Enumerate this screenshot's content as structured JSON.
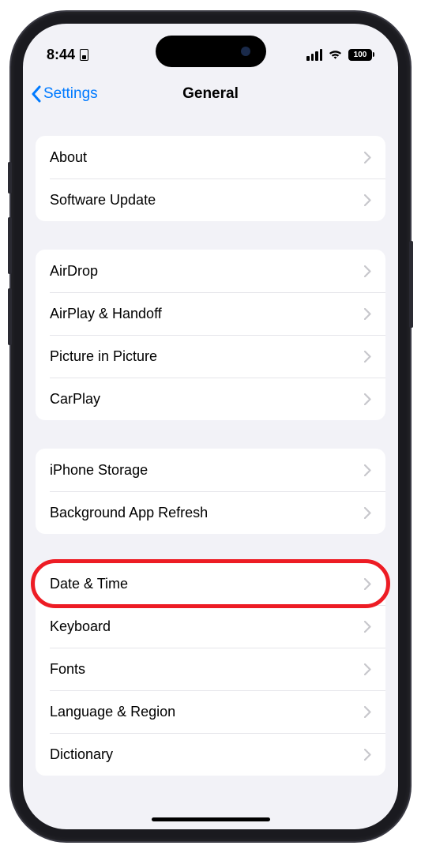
{
  "status": {
    "time": "8:44",
    "battery": "100"
  },
  "nav": {
    "back_label": "Settings",
    "title": "General"
  },
  "groups": [
    {
      "items": [
        {
          "key": "about",
          "label": "About"
        },
        {
          "key": "software-update",
          "label": "Software Update"
        }
      ]
    },
    {
      "items": [
        {
          "key": "airdrop",
          "label": "AirDrop"
        },
        {
          "key": "airplay-handoff",
          "label": "AirPlay & Handoff"
        },
        {
          "key": "picture-in-picture",
          "label": "Picture in Picture"
        },
        {
          "key": "carplay",
          "label": "CarPlay"
        }
      ]
    },
    {
      "items": [
        {
          "key": "iphone-storage",
          "label": "iPhone Storage"
        },
        {
          "key": "background-app-refresh",
          "label": "Background App Refresh"
        }
      ]
    },
    {
      "items": [
        {
          "key": "date-time",
          "label": "Date & Time",
          "highlighted": true
        },
        {
          "key": "keyboard",
          "label": "Keyboard"
        },
        {
          "key": "fonts",
          "label": "Fonts"
        },
        {
          "key": "language-region",
          "label": "Language & Region"
        },
        {
          "key": "dictionary",
          "label": "Dictionary"
        }
      ]
    }
  ]
}
